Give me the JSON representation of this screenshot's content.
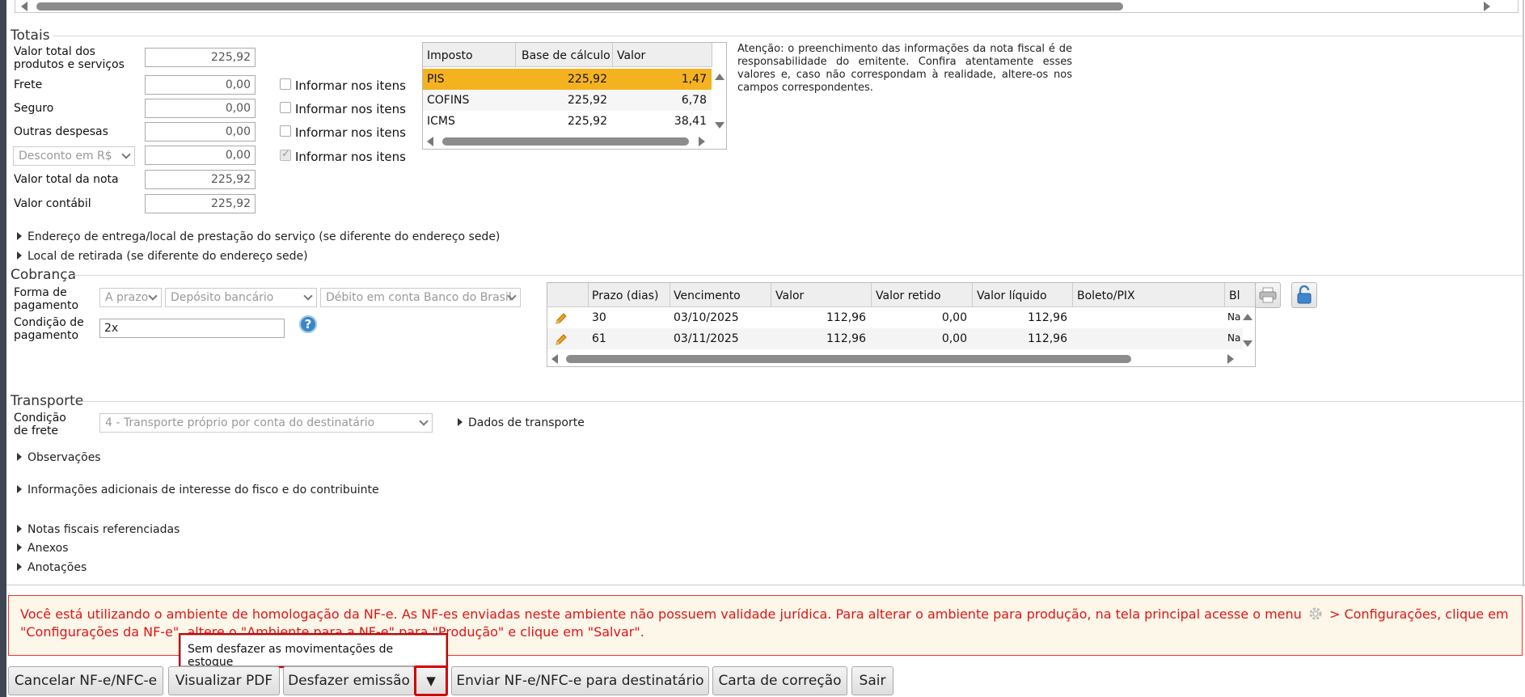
{
  "totais": {
    "title": "Totais",
    "valor_total_produtos_label": "Valor total dos produtos e serviços",
    "valor_total_produtos": "225,92",
    "frete_label": "Frete",
    "frete": "0,00",
    "seguro_label": "Seguro",
    "seguro": "0,00",
    "outras_despesas_label": "Outras despesas",
    "outras_despesas": "0,00",
    "desconto_select": "Desconto em R$",
    "desconto": "0,00",
    "valor_total_nota_label": "Valor total da nota",
    "valor_total_nota": "225,92",
    "valor_contabil_label": "Valor contábil",
    "valor_contabil": "225,92",
    "informar_nos_itens": "Informar nos itens"
  },
  "impostos": {
    "headers": [
      "Imposto",
      "Base de cálculo",
      "Valor"
    ],
    "rows": [
      {
        "imposto": "PIS",
        "base": "225,92",
        "valor": "1,47"
      },
      {
        "imposto": "COFINS",
        "base": "225,92",
        "valor": "6,78"
      },
      {
        "imposto": "ICMS",
        "base": "225,92",
        "valor": "38,41"
      }
    ],
    "selected_color": "#f5b220"
  },
  "atencao": "Atenção: o preenchimento das informações da nota fiscal é de responsabilidade do emitente. Confira atentamente esses valores e, caso não correspondam à realidade, altere-os nos campos correspondentes.",
  "expanders": {
    "endereco_entrega": "Endereço de entrega/local de prestação do serviço (se diferente do endereço sede)",
    "local_retirada": "Local de retirada (se diferente do endereço sede)",
    "dados_transporte": "Dados de transporte",
    "observacoes": "Observações",
    "info_adicionais": "Informações adicionais de interesse do fisco e do contribuinte",
    "notas_referenciadas": "Notas fiscais referenciadas",
    "anexos": "Anexos",
    "anotacoes": "Anotações"
  },
  "cobranca": {
    "title": "Cobrança",
    "forma_label": "Forma de pagamento",
    "forma_select_1": "A prazo",
    "forma_select_2": "Depósito bancário",
    "forma_select_3": "Débito em conta Banco do Brasil",
    "condicao_label": "Condição de pagamento",
    "condicao_value": "2x",
    "help": "?",
    "headers": [
      "Prazo (dias)",
      "Vencimento",
      "Valor",
      "Valor retido",
      "Valor líquido",
      "Boleto/PIX",
      "Bl"
    ],
    "rows": [
      {
        "prazo": "30",
        "vencimento": "03/10/2025",
        "valor": "112,96",
        "retido": "0,00",
        "liquido": "112,96",
        "boleto": "",
        "bl": "Na"
      },
      {
        "prazo": "61",
        "vencimento": "03/11/2025",
        "valor": "112,96",
        "retido": "0,00",
        "liquido": "112,96",
        "boleto": "",
        "bl": "Na"
      }
    ]
  },
  "transporte": {
    "title": "Transporte",
    "condicao_frete_label": "Condição de frete",
    "condicao_frete_value": "4 - Transporte próprio por conta do destinatário"
  },
  "aviso": {
    "text1": "Você está utilizando o ambiente de homologação da NF-e. As NF-es enviadas neste ambiente não possuem validade jurídica. Para alterar o ambiente para produção, na tela principal acesse o menu",
    "text2": "> Configurações,",
    "text3": "clique em \"Configurações da NF-e\", altere o \"Ambiente para a NF-e\" para \"Produção\" e clique em \"Salvar\"."
  },
  "dropdown": {
    "sem_desfazer": "Sem desfazer as movimentações de estoque"
  },
  "buttons": {
    "cancelar": "Cancelar NF-e/NFC-e",
    "visualizar": "Visualizar PDF",
    "desfazer": "Desfazer emissão",
    "dropdown_arrow": "▼",
    "enviar": "Enviar NF-e/NFC-e para destinatário",
    "carta": "Carta de correção",
    "sair": "Sair"
  }
}
